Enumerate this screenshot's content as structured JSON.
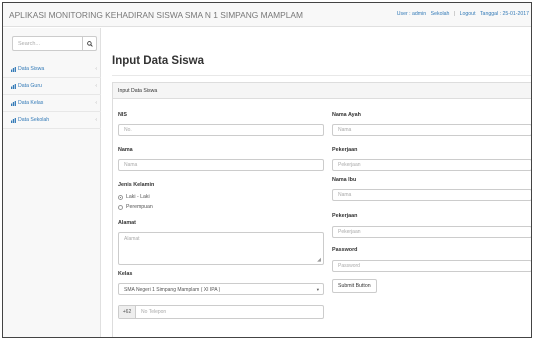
{
  "header": {
    "title": "APLIKASI MONITORING KEHADIRAN SISWA SMA N 1 SIMPANG MAMPLAM",
    "user": "User : admin",
    "sekolah": "Sekolah",
    "separator": "|",
    "logout": "Logout",
    "date": "Tanggal : 25-01-2017"
  },
  "sidebar": {
    "search_placeholder": "Search...",
    "items": [
      {
        "label": "Data Siswa"
      },
      {
        "label": "Data Guru"
      },
      {
        "label": "Data Kelas"
      },
      {
        "label": "Data Sekolah"
      }
    ],
    "arrow": "‹"
  },
  "page": {
    "title": "Input Data Siswa",
    "panel_heading": "Input Data Siswa"
  },
  "form": {
    "nis": {
      "label": "NIS",
      "placeholder": "No."
    },
    "nama": {
      "label": "Nama",
      "placeholder": "Nama"
    },
    "jenis_kelamin": {
      "label": "Jenis Kelamin",
      "options": [
        "Laki - Laki",
        "Perempuan"
      ],
      "selected": "Laki - Laki"
    },
    "alamat": {
      "label": "Alamat",
      "placeholder": "Alamat"
    },
    "kelas": {
      "label": "Kelas",
      "selected": "SMA Negeri 1 Simpang Mamplam ( XI IPA )"
    },
    "telepon": {
      "prefix": "+62",
      "placeholder": "No Telepon"
    },
    "nama_ayah": {
      "label": "Nama Ayah",
      "placeholder": "Nama"
    },
    "pekerjaan_ayah": {
      "label": "Pekerjaan",
      "placeholder": "Pekerjaan"
    },
    "nama_ibu": {
      "label": "Nama Ibu",
      "placeholder": "Nama"
    },
    "pekerjaan_ibu": {
      "label": "Pekerjaan",
      "placeholder": "Pekerjaan"
    },
    "password": {
      "label": "Password",
      "placeholder": "Password"
    },
    "submit_label": "Submit Button"
  },
  "colors": {
    "link": "#337ab7",
    "text": "#333333",
    "border": "#cccccc",
    "panel_bg": "#f5f5f5"
  },
  "icons": {
    "search": "search-icon",
    "nav": "dashboard-icon"
  }
}
